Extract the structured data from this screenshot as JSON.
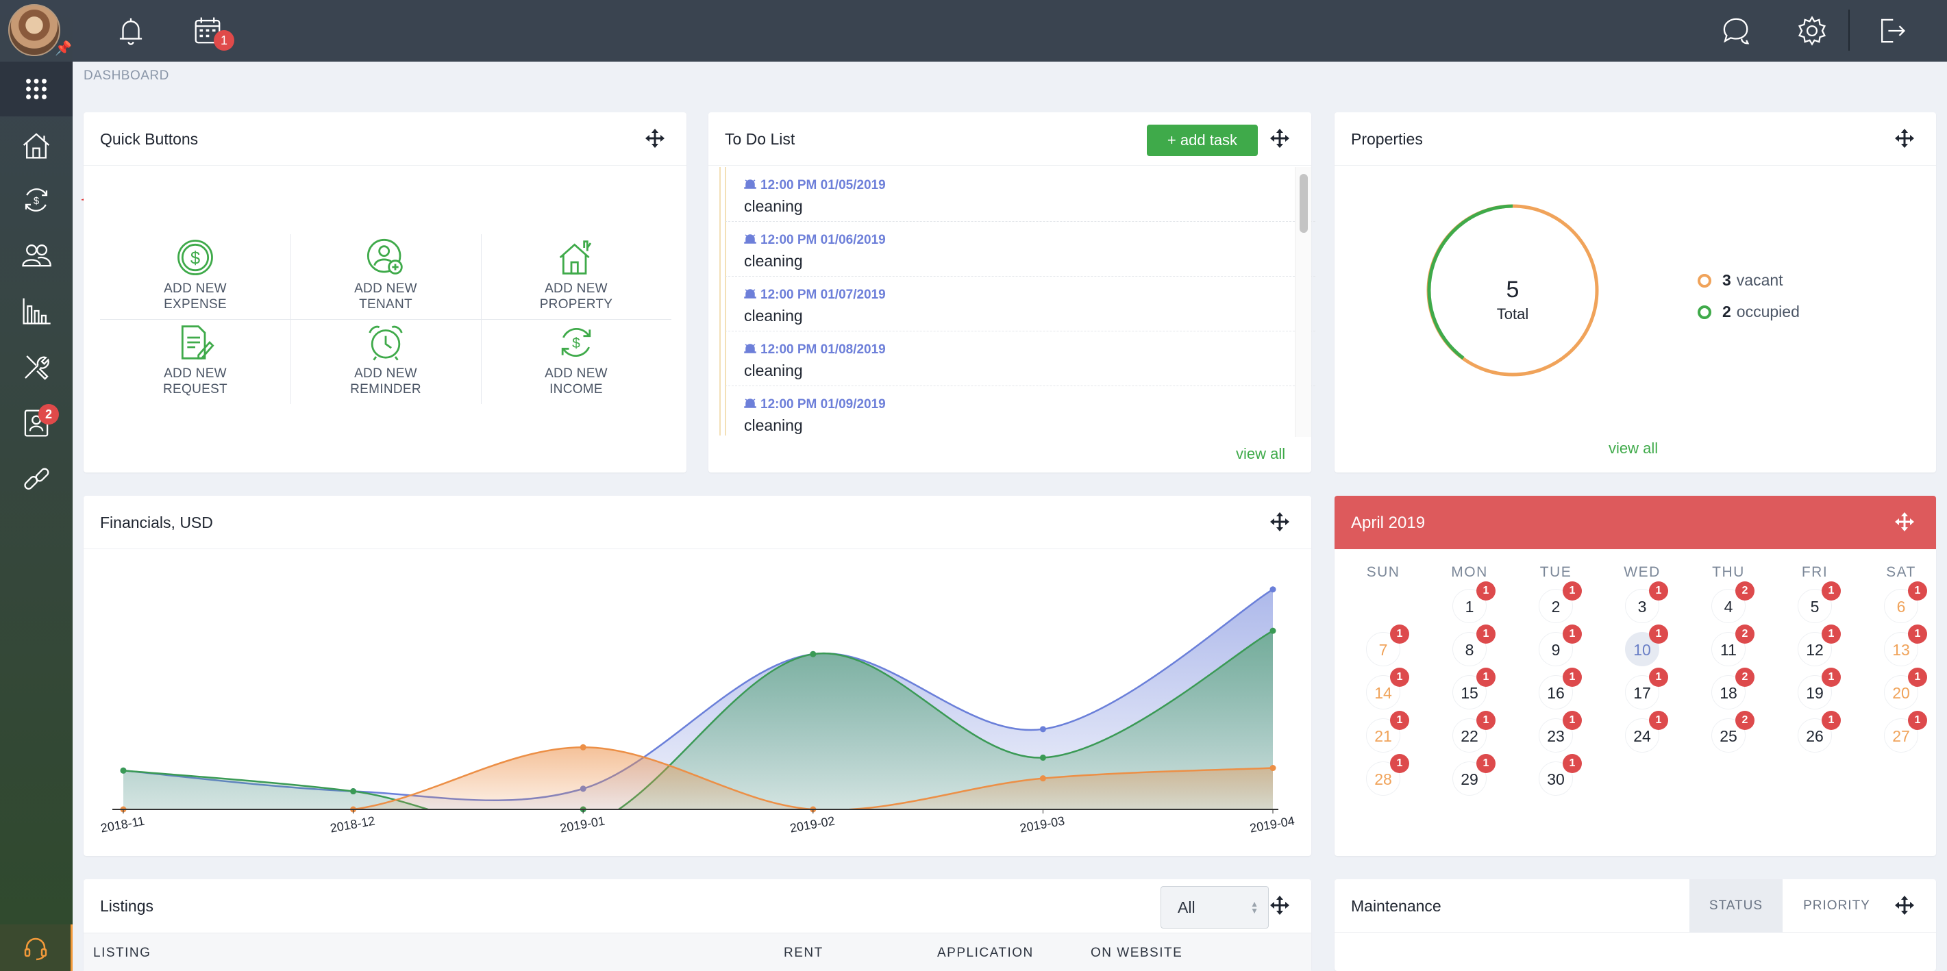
{
  "breadcrumb": "DASHBOARD",
  "sidebar": {
    "items": [
      {
        "icon": "apps-grid-icon"
      },
      {
        "icon": "house-icon"
      },
      {
        "icon": "money-refresh-icon"
      },
      {
        "icon": "people-icon"
      },
      {
        "icon": "bar-chart-icon"
      },
      {
        "icon": "tools-icon"
      },
      {
        "icon": "contact-card-icon",
        "badge": "2"
      },
      {
        "icon": "link-icon"
      }
    ]
  },
  "topbar": {
    "calendar_badge": "1"
  },
  "quick_buttons": {
    "title": "Quick Buttons",
    "items": [
      {
        "line1": "ADD NEW",
        "line2": "EXPENSE",
        "icon": "dollar-coin-icon"
      },
      {
        "line1": "ADD NEW",
        "line2": "TENANT",
        "icon": "add-user-icon"
      },
      {
        "line1": "ADD NEW",
        "line2": "PROPERTY",
        "icon": "house-icon"
      },
      {
        "line1": "ADD NEW",
        "line2": "REQUEST",
        "icon": "document-edit-icon"
      },
      {
        "line1": "ADD NEW",
        "line2": "REMINDER",
        "icon": "alarm-clock-icon"
      },
      {
        "line1": "ADD NEW",
        "line2": "INCOME",
        "icon": "money-refresh-icon"
      }
    ]
  },
  "todo": {
    "title": "To Do List",
    "add_label": "+ add task",
    "view_all": "view all",
    "items": [
      {
        "when": "12:00 PM  01/05/2019",
        "text": "cleaning"
      },
      {
        "when": "12:00 PM  01/06/2019",
        "text": "cleaning"
      },
      {
        "when": "12:00 PM  01/07/2019",
        "text": "cleaning"
      },
      {
        "when": "12:00 PM  01/08/2019",
        "text": "cleaning"
      },
      {
        "when": "12:00 PM  01/09/2019",
        "text": "cleaning"
      }
    ]
  },
  "properties": {
    "title": "Properties",
    "total": "5",
    "total_label": "Total",
    "vacant_count": "3",
    "vacant_label": "vacant",
    "occupied_count": "2",
    "occupied_label": "occupied",
    "view_all": "view all",
    "colors": {
      "vacant": "#f0a35a",
      "occupied": "#3faa4a"
    }
  },
  "financials": {
    "title": "Financials, USD"
  },
  "chart_data": {
    "type": "area",
    "title": "Financials, USD",
    "x": [
      "2018-11",
      "2018-12",
      "2019-01",
      "2019-02",
      "2019-03",
      "2019-04"
    ],
    "series": [
      {
        "color": "#6a7fd9",
        "values": [
          0.15,
          0.07,
          0.08,
          0.6,
          0.31,
          0.85
        ]
      },
      {
        "color": "#3a9a55",
        "values": [
          0.15,
          0.07,
          -0.07,
          0.6,
          0.2,
          0.69
        ]
      },
      {
        "color": "#ec8f46",
        "values": [
          0.0,
          0.0,
          0.24,
          0.0,
          0.12,
          0.16
        ]
      }
    ]
  },
  "calendar": {
    "title": "April  2019",
    "dow": [
      "SUN",
      "MON",
      "TUE",
      "WED",
      "THU",
      "FRI",
      "SAT"
    ],
    "today": 10,
    "days": [
      {
        "d": "1",
        "b": "1"
      },
      {
        "d": "2",
        "b": "1"
      },
      {
        "d": "3",
        "b": "1"
      },
      {
        "d": "4",
        "b": "2"
      },
      {
        "d": "5",
        "b": "1"
      },
      {
        "d": "6",
        "b": "1"
      },
      {
        "d": "7",
        "b": "1"
      },
      {
        "d": "8",
        "b": "1"
      },
      {
        "d": "9",
        "b": "1"
      },
      {
        "d": "10",
        "b": "1"
      },
      {
        "d": "11",
        "b": "2"
      },
      {
        "d": "12",
        "b": "1"
      },
      {
        "d": "13",
        "b": "1"
      },
      {
        "d": "14",
        "b": "1"
      },
      {
        "d": "15",
        "b": "1"
      },
      {
        "d": "16",
        "b": "1"
      },
      {
        "d": "17",
        "b": "1"
      },
      {
        "d": "18",
        "b": "2"
      },
      {
        "d": "19",
        "b": "1"
      },
      {
        "d": "20",
        "b": "1"
      },
      {
        "d": "21",
        "b": "1"
      },
      {
        "d": "22",
        "b": "1"
      },
      {
        "d": "23",
        "b": "1"
      },
      {
        "d": "24",
        "b": "1"
      },
      {
        "d": "25",
        "b": "2"
      },
      {
        "d": "26",
        "b": "1"
      },
      {
        "d": "27",
        "b": "1"
      },
      {
        "d": "28",
        "b": "1"
      },
      {
        "d": "29",
        "b": "1"
      },
      {
        "d": "30",
        "b": "1"
      }
    ],
    "first_weekday": 1
  },
  "listings": {
    "title": "Listings",
    "filter_value": "All",
    "columns": [
      "LISTING",
      "RENT",
      "APPLICATION",
      "ON WEBSITE"
    ]
  },
  "maintenance": {
    "title": "Maintenance",
    "tabs": [
      "STATUS",
      "PRIORITY"
    ]
  }
}
